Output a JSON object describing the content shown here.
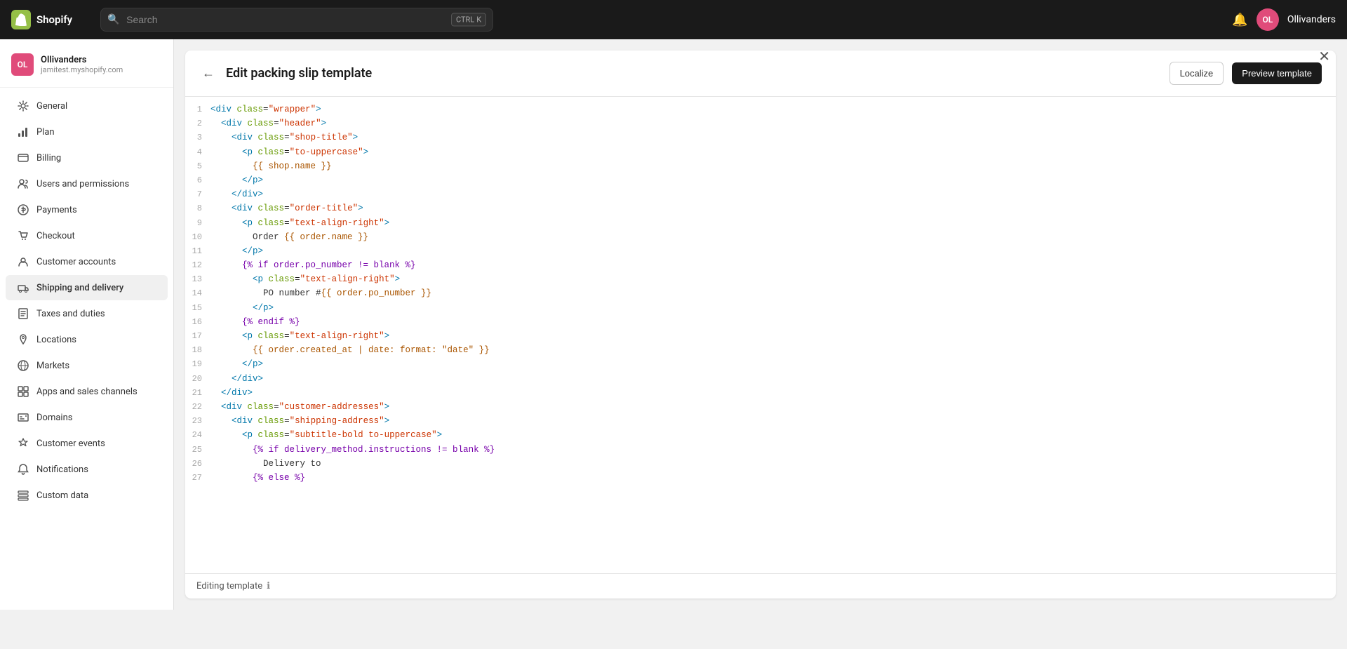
{
  "topnav": {
    "logo_text": "Shopify",
    "logo_abbr": "S",
    "search_placeholder": "Search",
    "kbd_ctrl": "CTRL",
    "kbd_k": "K",
    "username": "Ollivanders",
    "avatar_initials": "OL"
  },
  "sidebar": {
    "store_name": "Ollivanders",
    "store_domain": "jamitest.myshopify.com",
    "store_avatar_initials": "OL",
    "items": [
      {
        "id": "general",
        "label": "General",
        "icon": "⚙"
      },
      {
        "id": "plan",
        "label": "Plan",
        "icon": "📊"
      },
      {
        "id": "billing",
        "label": "Billing",
        "icon": "💳"
      },
      {
        "id": "users-permissions",
        "label": "Users and permissions",
        "icon": "👤"
      },
      {
        "id": "payments",
        "label": "Payments",
        "icon": "💰"
      },
      {
        "id": "checkout",
        "label": "Checkout",
        "icon": "🛒"
      },
      {
        "id": "customer-accounts",
        "label": "Customer accounts",
        "icon": "👥"
      },
      {
        "id": "shipping-delivery",
        "label": "Shipping and delivery",
        "icon": "🚚"
      },
      {
        "id": "taxes-duties",
        "label": "Taxes and duties",
        "icon": "📋"
      },
      {
        "id": "locations",
        "label": "Locations",
        "icon": "📍"
      },
      {
        "id": "markets",
        "label": "Markets",
        "icon": "🌐"
      },
      {
        "id": "apps-channels",
        "label": "Apps and sales channels",
        "icon": "🔌"
      },
      {
        "id": "domains",
        "label": "Domains",
        "icon": "🖥"
      },
      {
        "id": "customer-events",
        "label": "Customer events",
        "icon": "⚡"
      },
      {
        "id": "notifications",
        "label": "Notifications",
        "icon": "🔔"
      },
      {
        "id": "custom-data",
        "label": "Custom data",
        "icon": "🗄"
      }
    ]
  },
  "editor": {
    "back_label": "←",
    "title": "Edit packing slip template",
    "localize_label": "Localize",
    "preview_label": "Preview template",
    "bottom_label": "Editing template",
    "close_icon": "✕",
    "code_lines": [
      {
        "num": 1,
        "html": "<span class='tag'>&lt;div</span> <span class='attr-name'>class</span>=<span class='attr-value'>\"wrapper\"</span><span class='tag'>&gt;</span>"
      },
      {
        "num": 2,
        "html": "  <span class='tag'>&lt;div</span> <span class='attr-name'>class</span>=<span class='attr-value'>\"header\"</span><span class='tag'>&gt;</span>"
      },
      {
        "num": 3,
        "html": "    <span class='tag'>&lt;div</span> <span class='attr-name'>class</span>=<span class='attr-value'>\"shop-title\"</span><span class='tag'>&gt;</span>"
      },
      {
        "num": 4,
        "html": "      <span class='tag'>&lt;p</span> <span class='attr-name'>class</span>=<span class='attr-value'>\"to-uppercase\"</span><span class='tag'>&gt;</span>"
      },
      {
        "num": 5,
        "html": "        <span class='template-var'>{{ shop.name }}</span>"
      },
      {
        "num": 6,
        "html": "      <span class='tag'>&lt;/p&gt;</span>"
      },
      {
        "num": 7,
        "html": "    <span class='tag'>&lt;/div&gt;</span>"
      },
      {
        "num": 8,
        "html": "    <span class='tag'>&lt;div</span> <span class='attr-name'>class</span>=<span class='attr-value'>\"order-title\"</span><span class='tag'>&gt;</span>"
      },
      {
        "num": 9,
        "html": "      <span class='tag'>&lt;p</span> <span class='attr-name'>class</span>=<span class='attr-value'>\"text-align-right\"</span><span class='tag'>&gt;</span>"
      },
      {
        "num": 10,
        "html": "        <span class='plain'>Order </span><span class='template-var'>{{ order.name }}</span>"
      },
      {
        "num": 11,
        "html": "      <span class='tag'>&lt;/p&gt;</span>"
      },
      {
        "num": 12,
        "html": "      <span class='template-tag'>{% if order.po_number != blank %}</span>"
      },
      {
        "num": 13,
        "html": "        <span class='tag'>&lt;p</span> <span class='attr-name'>class</span>=<span class='attr-value'>\"text-align-right\"</span><span class='tag'>&gt;</span>"
      },
      {
        "num": 14,
        "html": "          <span class='plain'>PO number #</span><span class='template-var'>{{ order.po_number }}</span>"
      },
      {
        "num": 15,
        "html": "        <span class='tag'>&lt;/p&gt;</span>"
      },
      {
        "num": 16,
        "html": "      <span class='template-tag'>{% endif %}</span>"
      },
      {
        "num": 17,
        "html": "      <span class='tag'>&lt;p</span> <span class='attr-name'>class</span>=<span class='attr-value'>\"text-align-right\"</span><span class='tag'>&gt;</span>"
      },
      {
        "num": 18,
        "html": "        <span class='template-var'>{{ order.created_at | date: format: \"date\" }}</span>"
      },
      {
        "num": 19,
        "html": "      <span class='tag'>&lt;/p&gt;</span>"
      },
      {
        "num": 20,
        "html": "    <span class='tag'>&lt;/div&gt;</span>"
      },
      {
        "num": 21,
        "html": "  <span class='tag'>&lt;/div&gt;</span>"
      },
      {
        "num": 22,
        "html": "  <span class='tag'>&lt;div</span> <span class='attr-name'>class</span>=<span class='attr-value'>\"customer-addresses\"</span><span class='tag'>&gt;</span>"
      },
      {
        "num": 23,
        "html": "    <span class='tag'>&lt;div</span> <span class='attr-name'>class</span>=<span class='attr-value'>\"shipping-address\"</span><span class='tag'>&gt;</span>"
      },
      {
        "num": 24,
        "html": "      <span class='tag'>&lt;p</span> <span class='attr-name'>class</span>=<span class='attr-value'>\"subtitle-bold to-uppercase\"</span><span class='tag'>&gt;</span>"
      },
      {
        "num": 25,
        "html": "        <span class='template-tag'>{% if delivery_method.instructions != blank %}</span>"
      },
      {
        "num": 26,
        "html": "          <span class='plain'>Delivery to</span>"
      },
      {
        "num": 27,
        "html": "        <span class='template-tag'>{% else %}</span>"
      }
    ]
  }
}
